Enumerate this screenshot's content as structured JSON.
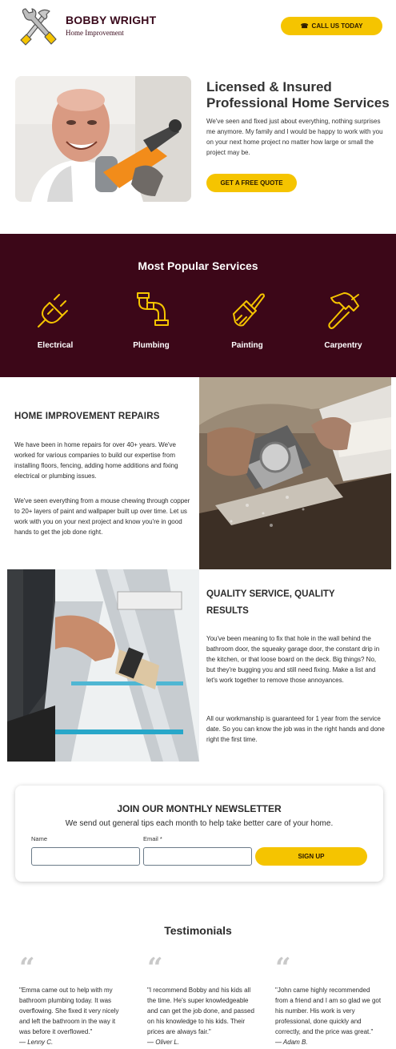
{
  "header": {
    "brand_name": "BOBBY WRIGHT",
    "brand_sub": "Home Improvement",
    "call_label": "CALL US TODAY",
    "phone_icon": "phone-icon"
  },
  "hero": {
    "title": "Licensed & Insured Professional Home Services",
    "text": "We've seen and fixed just about everything, nothing surprises me anymore. My family and I would be happy to work with you on your next home project no matter how large or small the project may be.",
    "cta": "GET A FREE QUOTE"
  },
  "services": {
    "title": "Most Popular Services",
    "items": [
      {
        "label": "Electrical",
        "icon": "plug-icon"
      },
      {
        "label": "Plumbing",
        "icon": "pipe-icon"
      },
      {
        "label": "Painting",
        "icon": "paintbrush-icon"
      },
      {
        "label": "Carpentry",
        "icon": "hammer-icon"
      }
    ]
  },
  "repairs": {
    "title": "HOME IMPROVEMENT REPAIRS",
    "p1": "We have been in home repairs for over 40+ years. We've worked for various companies to build our expertise from installing floors, fencing, adding home additions and fixing electrical or plumbing issues.",
    "p2": "We've seen everything from a mouse chewing through copper to 20+ layers of paint and wallpaper built up over time. Let us work with you on your next project and know you're in good hands to get the job done right."
  },
  "quality": {
    "title": "QUALITY SERVICE, QUALITY RESULTS",
    "p1": "You've been meaning to fix that hole in the wall behind the bathroom door, the squeaky garage door, the constant drip in the kitchen, or that loose board on the deck. Big things? No, but they're bugging you and still need fixing. Make a list and let's work together to remove those annoyances.",
    "p2": "All our workmanship is guaranteed for 1 year from the service date. So you can know the job was in the right hands and done right the first time."
  },
  "newsletter": {
    "title": "JOIN OUR MONTHLY NEWSLETTER",
    "subtitle": "We send out general tips each month to help take better care of your home.",
    "name_label": "Name",
    "email_label": "Email *",
    "name_value": "",
    "email_value": "",
    "submit": "SIGN UP"
  },
  "testimonials": {
    "title": "Testimonials",
    "items": [
      {
        "text": "\"Emma came out to help with my bathroom plumbing today. It was overflowing. She fixed it very nicely and left the bathroom in the way it was before it overflowed.\"",
        "author": "— Lenny C."
      },
      {
        "text": "\"I recommend Bobby and his kids all the time. He's super knowledgeable and can get the job done, and passed on his knowledge to his kids. Their prices are always fair.\"",
        "author": "— Oliver L."
      },
      {
        "text": "\"John came highly recommended from a friend and I am so glad we got his number. His work is very professional, done quickly and correctly, and the price was great.\"",
        "author": "— Adam B."
      }
    ]
  },
  "colors": {
    "accent": "#f5c400",
    "brand": "#3c0718"
  }
}
